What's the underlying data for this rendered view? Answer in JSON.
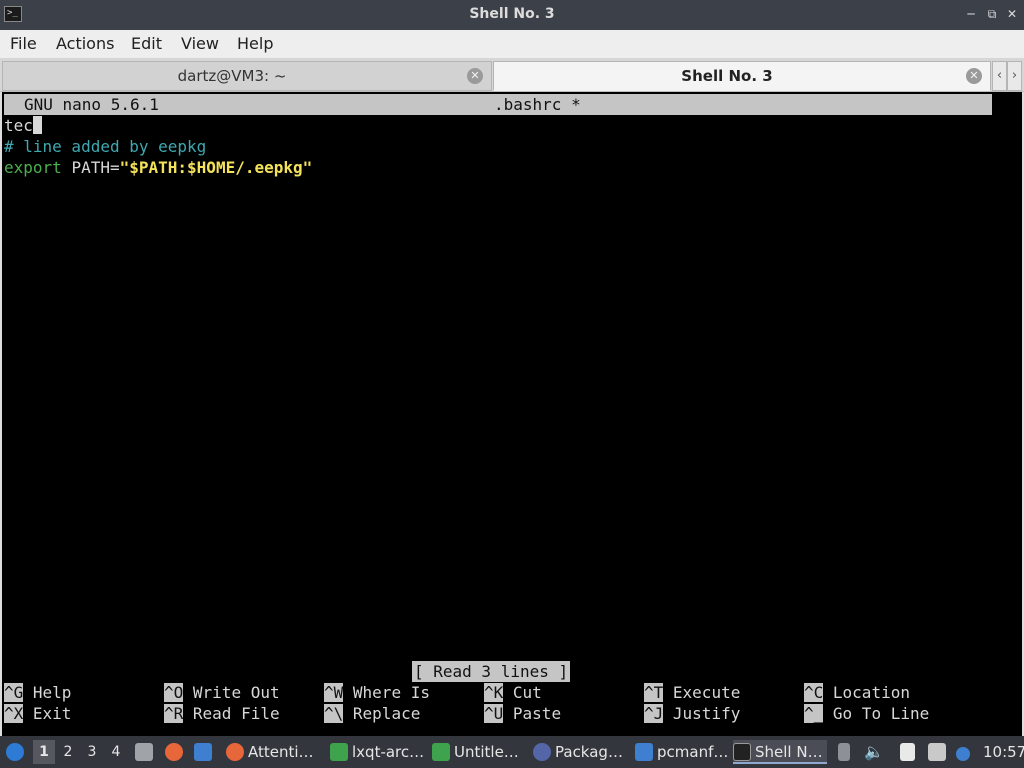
{
  "window": {
    "title": "Shell No. 3"
  },
  "menu": [
    "File",
    "Actions",
    "Edit",
    "View",
    "Help"
  ],
  "tabs": [
    {
      "label": "dartz@VM3: ~",
      "active": false
    },
    {
      "label": "Shell No. 3",
      "active": true
    }
  ],
  "nano": {
    "version": "GNU nano 5.6.1",
    "filename": ".bashrc *",
    "lines": [
      {
        "text": "tec"
      },
      {
        "text": "# line added by eepkg"
      },
      {
        "export_kw": "export",
        "var": "PATH=",
        "value": "\"$PATH:$HOME/.eepkg\""
      }
    ],
    "status": "[ Read 3 lines ]",
    "shortcuts": [
      {
        "key": "^G",
        "label": "Help"
      },
      {
        "key": "^O",
        "label": "Write Out"
      },
      {
        "key": "^W",
        "label": "Where Is"
      },
      {
        "key": "^K",
        "label": "Cut"
      },
      {
        "key": "^T",
        "label": "Execute"
      },
      {
        "key": "^C",
        "label": "Location"
      },
      {
        "key": "^X",
        "label": "Exit"
      },
      {
        "key": "^R",
        "label": "Read File"
      },
      {
        "key": "^\\",
        "label": "Replace"
      },
      {
        "key": "^U",
        "label": "Paste"
      },
      {
        "key": "^J",
        "label": "Justify"
      },
      {
        "key": "^_",
        "label": "Go To Line"
      }
    ]
  },
  "taskbar": {
    "desktops": [
      "1",
      "2",
      "3",
      "4"
    ],
    "tasks": [
      {
        "label": "Attenti…",
        "icon": "firefox-icon"
      },
      {
        "label": "lxqt-arc…",
        "icon": "spreadsheet-icon"
      },
      {
        "label": "Untitle…",
        "icon": "spreadsheet-icon"
      },
      {
        "label": "Packag…",
        "icon": "package-manager-icon"
      },
      {
        "label": "pcmanf…",
        "icon": "folder-icon"
      },
      {
        "label": "Shell N…",
        "icon": "terminal-icon",
        "active": true
      }
    ],
    "clock": "10:57"
  }
}
